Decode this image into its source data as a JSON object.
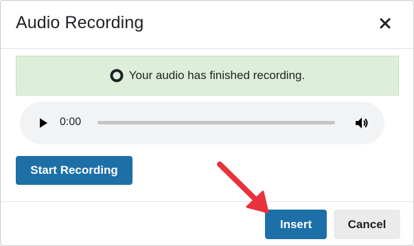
{
  "dialog": {
    "title": "Audio Recording",
    "close_icon": "close-icon"
  },
  "alert": {
    "icon": "ring-icon",
    "message": "Your audio has finished recording.",
    "background_color": "#deefd9"
  },
  "player": {
    "play_icon": "play-icon",
    "time": "0:00",
    "progress_fraction": 0,
    "volume_icon": "volume-icon"
  },
  "actions": {
    "start_recording_label": "Start Recording"
  },
  "footer": {
    "insert_label": "Insert",
    "cancel_label": "Cancel"
  },
  "annotation": {
    "arrow_icon": "arrow-icon",
    "arrow_color": "#e8323c"
  },
  "colors": {
    "primary": "#1d6fa8",
    "secondary": "#ebebeb"
  }
}
